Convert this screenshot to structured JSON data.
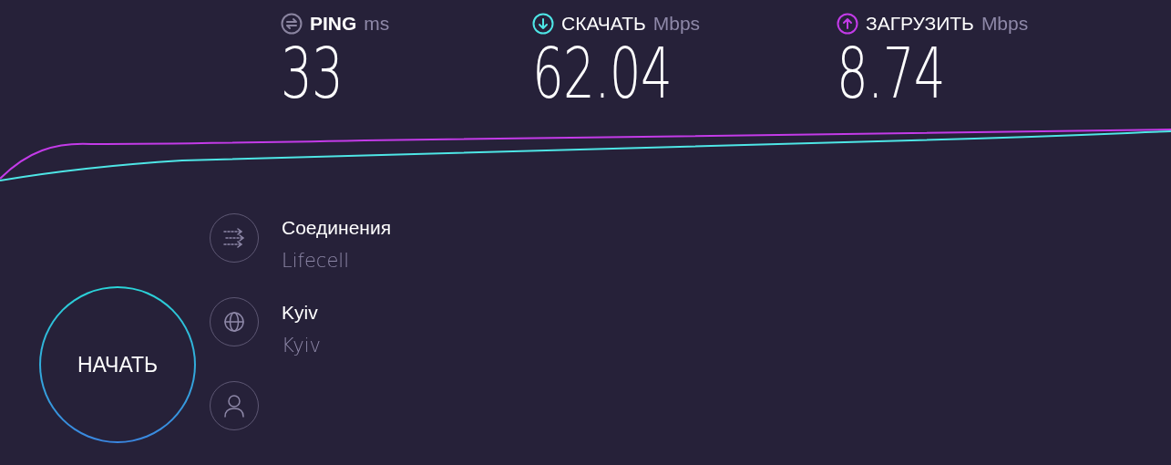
{
  "metrics": [
    {
      "kind": "ping",
      "color": "#8a84a0",
      "label": "PING",
      "unit": "ms",
      "value": "33"
    },
    {
      "kind": "download",
      "color": "#4ee6e6",
      "label": "СКАЧАТЬ",
      "unit": "Mbps",
      "value": "62.04"
    },
    {
      "kind": "upload",
      "color": "#c33be8",
      "label": "ЗАГРУЗИТЬ",
      "unit": "Mbps",
      "value": "8.74"
    }
  ],
  "start_button": "НАЧАТЬ",
  "info": [
    {
      "kind": "connections",
      "title": "Соединения",
      "subtitle": "Lifecell"
    },
    {
      "kind": "server",
      "title": "Kyiv",
      "subtitle": "Kyiv"
    },
    {
      "kind": "user"
    }
  ]
}
